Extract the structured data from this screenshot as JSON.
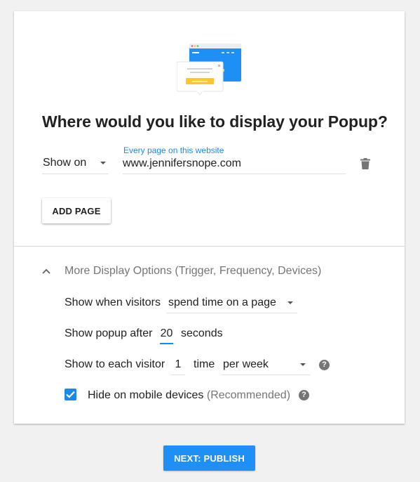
{
  "headline": "Where would you like to display your Popup?",
  "display_rule": {
    "show_on_value": "Show on",
    "url_label": "Every page on this website",
    "url_value": "www.jennifersnope.com",
    "add_page_label": "ADD PAGE"
  },
  "more_options": {
    "toggle_label": "More Display Options (Trigger, Frequency, Devices)",
    "trigger": {
      "label": "Show when visitors",
      "value": "spend time on a page"
    },
    "delay": {
      "label_before": "Show popup after",
      "value": "20",
      "label_after": "seconds"
    },
    "frequency": {
      "label": "Show to each visitor",
      "count": "1",
      "unit_label": "time",
      "period": "per week"
    },
    "mobile": {
      "checked": true,
      "label": "Hide on mobile devices",
      "note": "(Recommended)"
    }
  },
  "next_button_label": "NEXT: PUBLISH",
  "colors": {
    "accent": "#1e88e5",
    "publish_bg": "#1e90f5",
    "illustration_yellow": "#ffc72c"
  }
}
